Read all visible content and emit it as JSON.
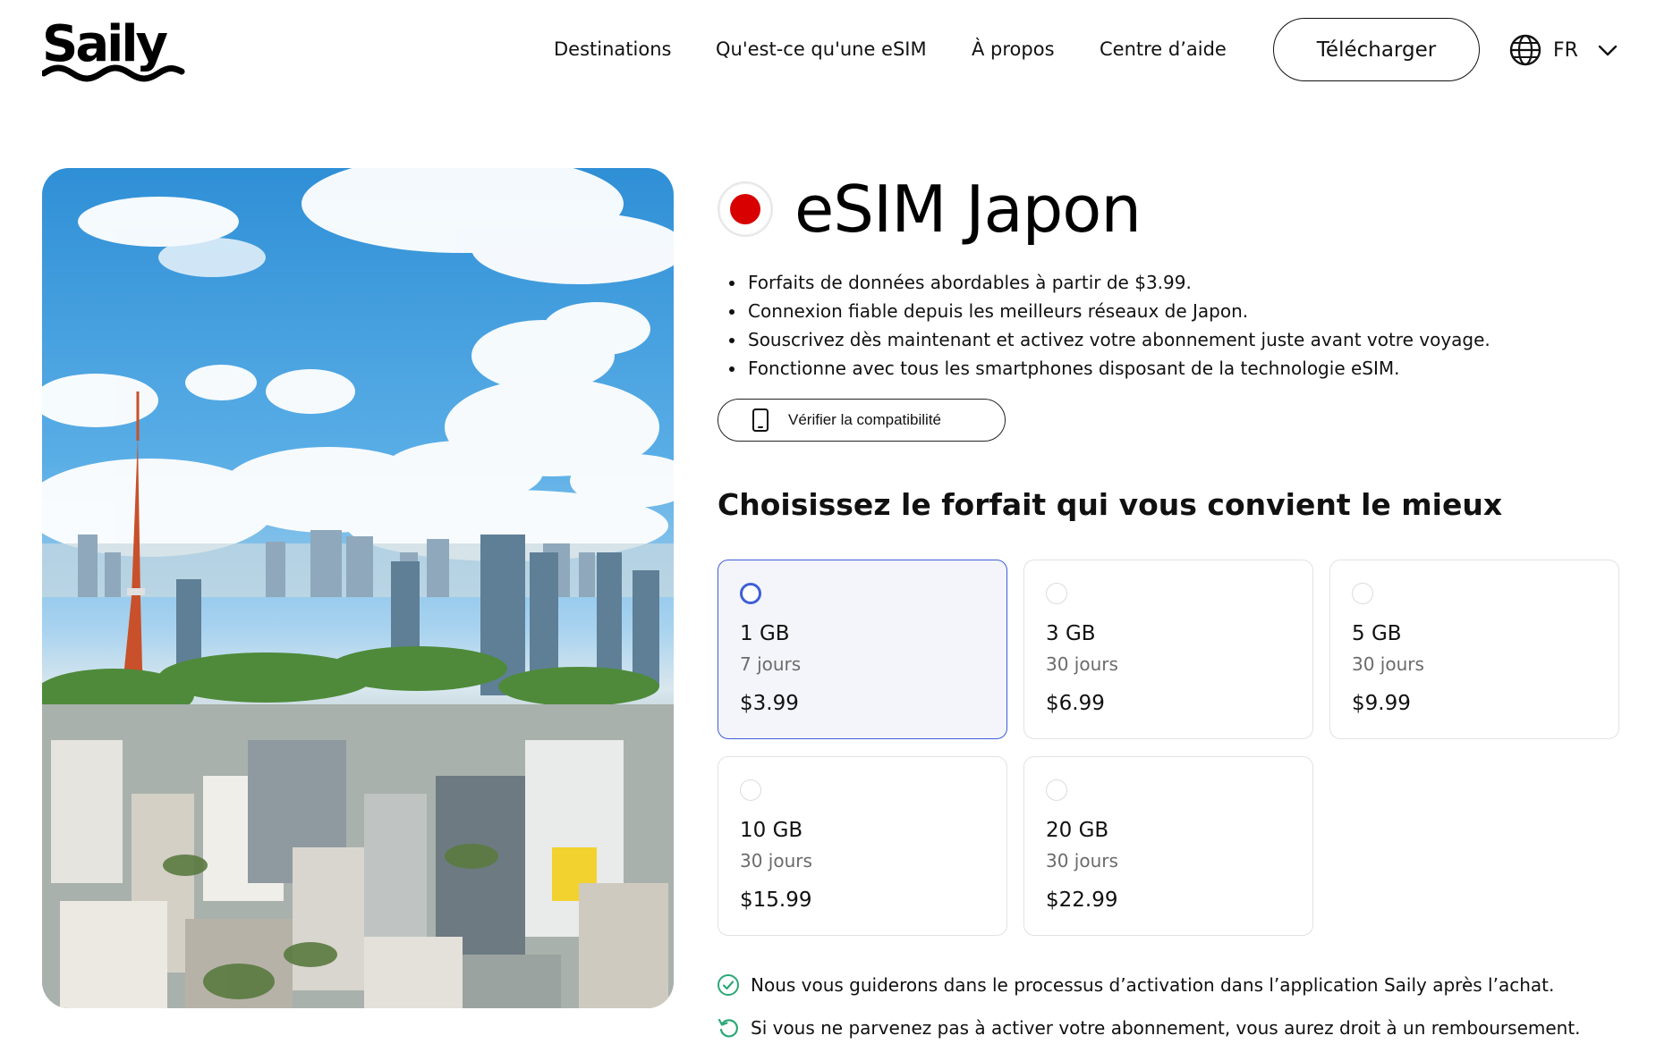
{
  "brand": {
    "name": "Saily"
  },
  "nav": {
    "items": [
      {
        "label": "Destinations"
      },
      {
        "label": "Qu'est-ce qu'une eSIM"
      },
      {
        "label": "À propos"
      },
      {
        "label": "Centre d’aide"
      }
    ],
    "download_label": "Télécharger",
    "language": "FR"
  },
  "product": {
    "title": "eSIM Japon",
    "flag_color": "#d80000",
    "features": [
      "Forfaits de données abordables à partir de $3.99.",
      "Connexion fiable depuis les meilleurs réseaux de Japon.",
      "Souscrivez dès maintenant et activez votre abonnement juste avant votre voyage.",
      "Fonctionne avec tous les smartphones disposant de la technologie eSIM."
    ],
    "compat_label": "Vérifier la compatibilité"
  },
  "plans": {
    "title": "Choisissez le forfait qui vous convient le mieux",
    "accent": "#3f5fd7",
    "items": [
      {
        "data": "1 GB",
        "duration": "7 jours",
        "price": "$3.99",
        "selected": true
      },
      {
        "data": "3 GB",
        "duration": "30 jours",
        "price": "$6.99",
        "selected": false
      },
      {
        "data": "5 GB",
        "duration": "30 jours",
        "price": "$9.99",
        "selected": false
      },
      {
        "data": "10 GB",
        "duration": "30 jours",
        "price": "$15.99",
        "selected": false
      },
      {
        "data": "20 GB",
        "duration": "30 jours",
        "price": "$22.99",
        "selected": false
      }
    ]
  },
  "notes": [
    {
      "icon": "check-circle-icon",
      "color": "#2aa876",
      "text": "Nous vous guiderons dans le processus d’activation dans l’application Saily après l’achat."
    },
    {
      "icon": "refund-arrow-icon",
      "color": "#2aa876",
      "text": "Si vous ne parvenez pas à activer votre abonnement, vous aurez droit à un remboursement."
    }
  ]
}
